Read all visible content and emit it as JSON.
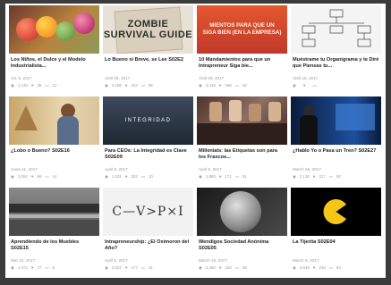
{
  "cards": [
    {
      "title": "Los Niños, el Dulce y el Modelo Industrialista...",
      "date": "Jul. 5, 2017",
      "views": "1,133",
      "likes": "38",
      "comments": "12",
      "thumb_text": ""
    },
    {
      "title": "Lo Bueno si Breve, se Lee S02E2",
      "date": "Abril 05, 2017",
      "views": "2,188",
      "likes": "223",
      "comments": "95",
      "thumb_text": "ZOMBIE SURVIVAL GUIDE"
    },
    {
      "title": "10 Mandamientos para que un Intrapreneur Siga bie...",
      "date": "Abril 09, 2017",
      "views": "4,418",
      "likes": "188",
      "comments": "52",
      "thumb_text": "MIENTOS PARA QUE UN SIGA BIEN (EN LA EMPRESA)"
    },
    {
      "title": "Muéstrame tu Organigrama y te Diré que Piensas tu...",
      "date": "Abril 18, 2017",
      "views": "",
      "likes": "",
      "comments": "",
      "thumb_text": ""
    },
    {
      "title": "¿Lobo o Bueno? S02E16",
      "date": "Junio 11, 2017",
      "views": "1,084",
      "likes": "68",
      "comments": "14",
      "thumb_text": ""
    },
    {
      "title": "Para CEOs: La Integridad es Clave S02E09",
      "date": "April 6, 2017",
      "views": "1,101",
      "likes": "202",
      "comments": "10",
      "thumb_text": "INTEGRIDAD"
    },
    {
      "title": "Millenials: las Etiquetas son para los Frascos...",
      "date": "April 5, 2017",
      "views": "1,883",
      "likes": "171",
      "comments": "51",
      "thumb_text": ""
    },
    {
      "title": "¿Hablo Yo o Pasa un Tren? S02E27",
      "date": "March 26, 2017",
      "views": "3,130",
      "likes": "217",
      "comments": "92",
      "thumb_text": ""
    },
    {
      "title": "Aprendiendo de los Muebles S02E15",
      "date": "Mar 21, 2017",
      "views": "1,372",
      "likes": "77",
      "comments": "8",
      "thumb_text": ""
    },
    {
      "title": "Intrapreneurship: ¿El Oximoron del Año?",
      "date": "April 5, 2017",
      "views": "2,037",
      "likes": "177",
      "comments": "41",
      "thumb_text": "C—V>P×I"
    },
    {
      "title": "Wendigos Sociedad Anónima S02E05",
      "date": "March 16, 2017",
      "views": "2,460",
      "likes": "183",
      "comments": "30",
      "thumb_text": ""
    },
    {
      "title": "La Tijerita S02E04",
      "date": "March 9, 2017",
      "views": "3,645",
      "likes": "248",
      "comments": "63",
      "thumb_text": ""
    }
  ],
  "colors": {
    "window": "#3b3b3b",
    "card_bg": "#ffffff",
    "title": "#222222",
    "meta": "#9a9a9a"
  }
}
